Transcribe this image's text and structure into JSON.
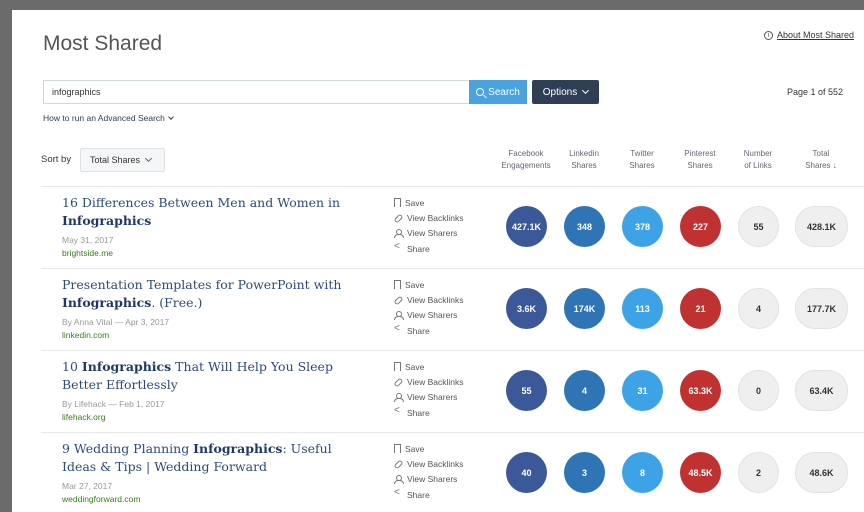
{
  "header": {
    "title": "Most Shared",
    "about_label": "About Most Shared"
  },
  "search": {
    "value": "infographics",
    "button_label": "Search",
    "options_label": "Options",
    "page_info": "Page 1 of 552",
    "advanced_link": "How to run an Advanced Search"
  },
  "sort": {
    "label": "Sort by",
    "selected": "Total Shares"
  },
  "columns": [
    {
      "line1": "Facebook",
      "line2": "Engagements"
    },
    {
      "line1": "Linkedin",
      "line2": "Shares"
    },
    {
      "line1": "Twitter",
      "line2": "Shares"
    },
    {
      "line1": "Pinterest",
      "line2": "Shares"
    },
    {
      "line1": "Number",
      "line2": "of Links"
    },
    {
      "line1": "Total",
      "line2": "Shares ↓"
    }
  ],
  "actions": [
    "Save",
    "View Backlinks",
    "View Sharers",
    "Share"
  ],
  "colors": {
    "facebook": "#3b5998",
    "linkedin": "#2f74b5",
    "twitter": "#3da3e6",
    "pinterest": "#c03131",
    "options_button": "#2e3f55",
    "search_button": "#4aa3df",
    "domain_green": "#3a7d1e"
  },
  "results": [
    {
      "title_pre": "16 Differences Between Men and Women in ",
      "title_bold": "Infographics",
      "title_post": "",
      "meta": "May 31, 2017",
      "domain": "brightside.me",
      "facebook": "427.1K",
      "linkedin": "348",
      "twitter": "378",
      "pinterest": "227",
      "links": "55",
      "total": "428.1K"
    },
    {
      "title_pre": "Presentation Templates for PowerPoint with ",
      "title_bold": "Infographics",
      "title_post": ". (Free.)",
      "meta": "By Anna Vital — Apr 3, 2017",
      "domain": "linkedin.com",
      "facebook": "3.6K",
      "linkedin": "174K",
      "twitter": "113",
      "pinterest": "21",
      "links": "4",
      "total": "177.7K"
    },
    {
      "title_pre": "10 ",
      "title_bold": "Infographics",
      "title_post": " That Will Help You Sleep Better Effortlessly",
      "meta": "By Lifehack — Feb 1, 2017",
      "domain": "lifehack.org",
      "facebook": "55",
      "linkedin": "4",
      "twitter": "31",
      "pinterest": "63.3K",
      "links": "0",
      "total": "63.4K"
    },
    {
      "title_pre": "9 Wedding Planning ",
      "title_bold": "Infographics",
      "title_post": ": Useful Ideas & Tips | Wedding Forward",
      "meta": "Mar 27, 2017",
      "domain": "weddingforward.com",
      "facebook": "40",
      "linkedin": "3",
      "twitter": "8",
      "pinterest": "48.5K",
      "links": "2",
      "total": "48.6K"
    }
  ]
}
